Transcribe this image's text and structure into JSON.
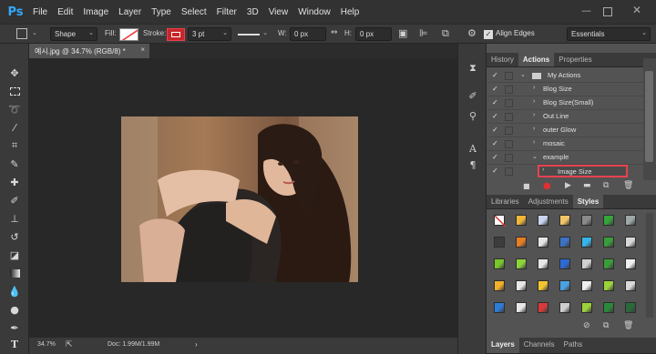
{
  "app": {
    "logo": "Ps"
  },
  "menu": [
    "File",
    "Edit",
    "Image",
    "Layer",
    "Type",
    "Select",
    "Filter",
    "3D",
    "View",
    "Window",
    "Help"
  ],
  "options": {
    "shape_mode": "Shape",
    "fill_label": "Fill:",
    "stroke_label": "Stroke:",
    "stroke_width": "3 pt",
    "w_label": "W:",
    "w_value": "0 px",
    "h_label": "H:",
    "h_value": "0 px",
    "align_edges": "Align Edges",
    "workspace": "Essentials"
  },
  "document": {
    "tab_title": "예시.jpg @ 34.7% (RGB/8) *",
    "close": "×"
  },
  "status": {
    "zoom": "34.7%",
    "doc": "Doc: 1.99M/1.99M"
  },
  "panel_top_tabs": [
    "History",
    "Actions",
    "Properties"
  ],
  "actions": {
    "set_name": "My Actions",
    "items": [
      "Blog Size",
      "Blog Size(Small)",
      "Out Line",
      "outer Glow",
      "mosaic"
    ],
    "sub_set": "example",
    "selected_item": "Image Size"
  },
  "panel_mid_tabs": [
    "Libraries",
    "Adjustments",
    "Styles"
  ],
  "panel_bottom_tabs": [
    "Layers",
    "Channels",
    "Paths"
  ],
  "colors": {
    "highlight": "#e8424f",
    "accent": "#31a8ff"
  },
  "styles_swatches": [
    [
      "#ffffff",
      "#f2b63a",
      "#c9d5f0",
      "#f4c66a",
      "#8a8a8a",
      "#35a43a",
      "#9ea8a8"
    ],
    [
      "#3c3c3c",
      "#e67e22",
      "#e6e6e6",
      "#3d71c4",
      "#37b4e8",
      "#3a9c3a",
      "#d8d8d8"
    ],
    [
      "#79c82a",
      "#8cd43a",
      "#e8e8e8",
      "#2d6ad1",
      "#d1d1d1",
      "#3a9c3a",
      "#f0f0f0"
    ],
    [
      "#f1b02a",
      "#e8e8e8",
      "#f5c531",
      "#4aa3e0",
      "#f0f0f0",
      "#9bd23a",
      "#d8d8d8"
    ],
    [
      "#2d7dd8",
      "#e8e8e8",
      "#d63a3a",
      "#cfcfcf",
      "#9bd23a",
      "#2a8a3a",
      "#2a6a3a"
    ]
  ],
  "icons": [
    "move-icon",
    "marquee-icon",
    "lasso-icon",
    "magic-wand-icon",
    "crop-icon",
    "eyedropper-icon",
    "healing-icon",
    "brush-icon",
    "stamp-icon",
    "history-brush-icon",
    "eraser-icon",
    "gradient-icon",
    "blur-icon",
    "dodge-icon",
    "pen-icon",
    "type-icon"
  ]
}
